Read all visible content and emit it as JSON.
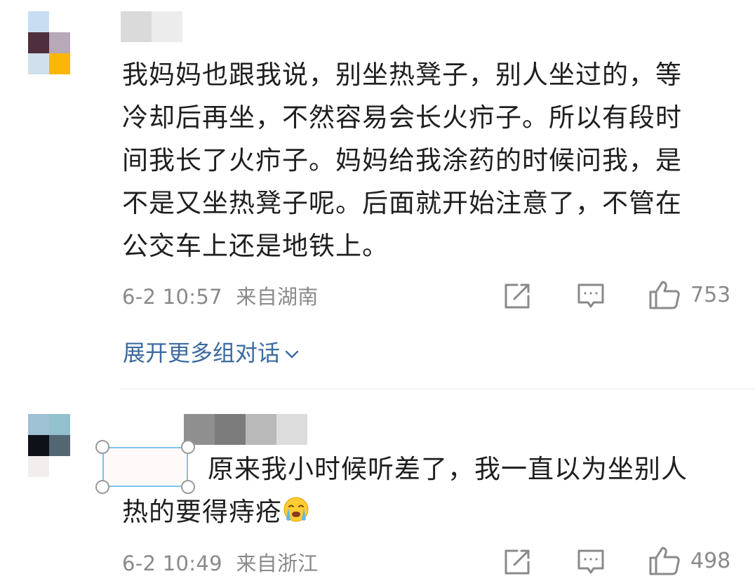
{
  "comments": [
    {
      "text_lines": [
        "我妈妈也跟我说，别坐热凳子，别人坐过的，等",
        "冷却后再坐，不然容易会长火疖子。所以有段时",
        "间我长了火疖子。妈妈给我涂药的时候问我，是",
        "不是又坐热凳子呢。后面就开始注意了，不管在",
        "公交车上还是地铁上。"
      ],
      "timestamp": "6-2 10:57",
      "location": "来自湖南",
      "likes": "753",
      "expand_label": "展开更多组对话",
      "avatar_icon": "avatar-icon",
      "avatar_colors": [
        "#c7def2",
        "#ffffff",
        "#ffffff",
        "#4f2e3d",
        "#b7a9b8",
        "#ffffff",
        "#cfe0ec",
        "#fbb60a",
        "#ffffff"
      ],
      "username_colors": [
        "#dadada",
        "#ececec"
      ]
    },
    {
      "text_line1": "原来我小时候听差了，我一直以为坐别人",
      "text_line2": "热的要得痔疮",
      "emoji": "crying-face-emoji",
      "timestamp": "6-2 10:49",
      "location": "来自浙江",
      "likes": "498",
      "avatar_colors": [
        "#9fc1d4",
        "#92c0cd",
        "#ffffff",
        "#0e1118",
        "#556673",
        "#ffffff",
        "#f2eeed",
        "#ffffff",
        "#ffffff"
      ],
      "username_colors": [
        "#8f8f8f",
        "#7c7c7c",
        "#b9b9b9",
        "#dcdcdc"
      ]
    }
  ],
  "icons": {
    "share": "share-icon",
    "comment": "comment-icon",
    "like": "thumbs-up-icon",
    "chevron": "chevron-down-icon"
  },
  "colors": {
    "text": "#1f1f1f",
    "meta": "#8a8a8a",
    "link": "#3b6aa0",
    "selection": "#7fc3ec"
  }
}
